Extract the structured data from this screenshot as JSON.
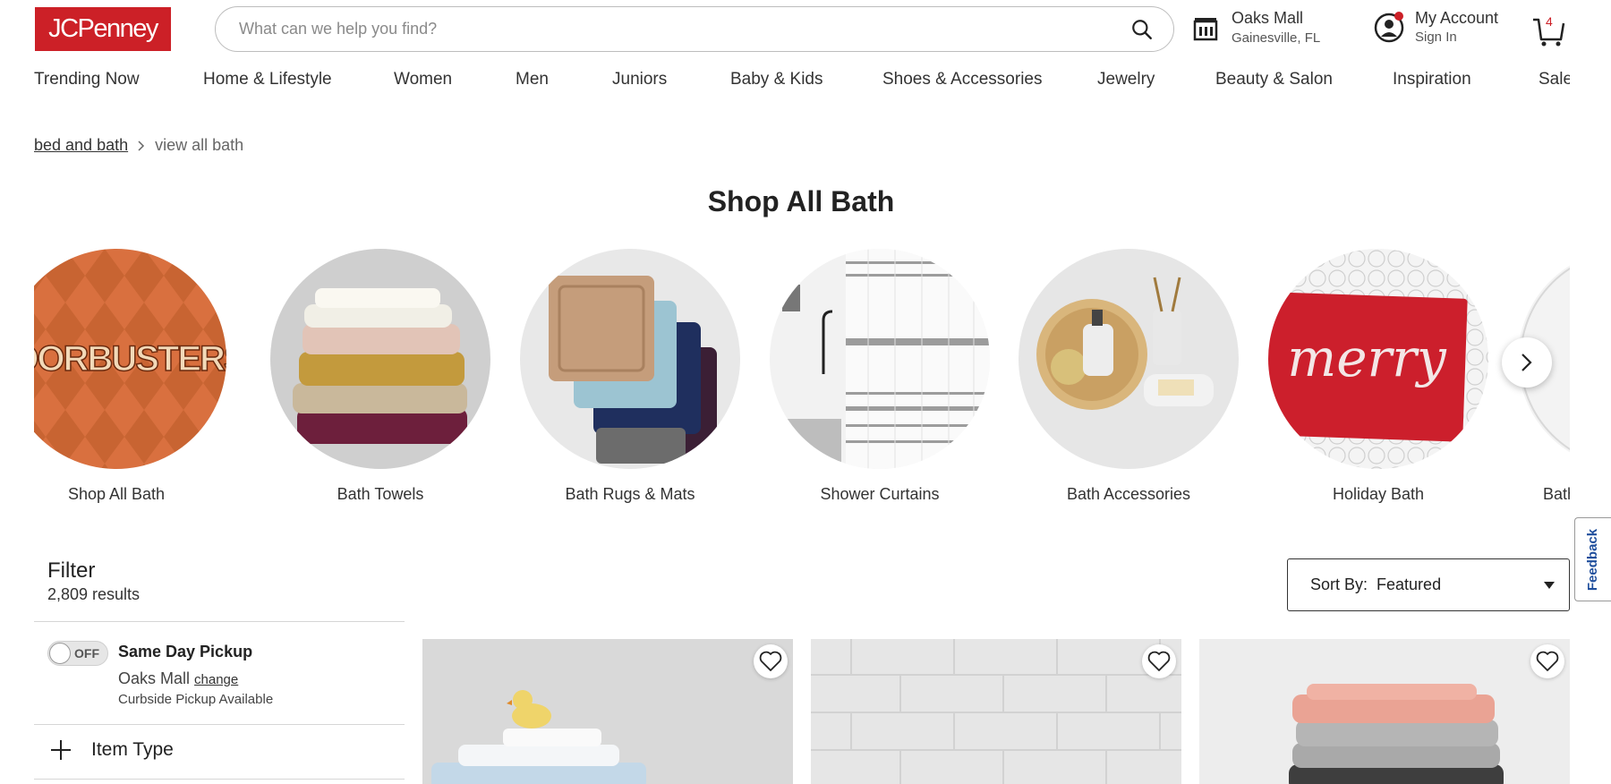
{
  "header": {
    "logo_text": "JCPenney",
    "search_placeholder": "What can we help you find?",
    "store_name": "Oaks Mall",
    "store_city": "Gainesville, FL",
    "account_title": "My Account",
    "account_sub": "Sign In",
    "cart_count": "4"
  },
  "nav": [
    "Trending Now",
    "Home & Lifestyle",
    "Women",
    "Men",
    "Juniors",
    "Baby & Kids",
    "Shoes & Accessories",
    "Jewelry",
    "Beauty & Salon",
    "Inspiration",
    "Sale"
  ],
  "breadcrumb": {
    "parent": "bed and bath",
    "current": "view all bath"
  },
  "page_title": "Shop All Bath",
  "categories": [
    {
      "label": "Shop All Bath",
      "image_text": "DOORBUSTERS"
    },
    {
      "label": "Bath Towels"
    },
    {
      "label": "Bath Rugs & Mats"
    },
    {
      "label": "Shower Curtains"
    },
    {
      "label": "Bath Accessories"
    },
    {
      "label": "Holiday Bath",
      "image_text": "merry"
    },
    {
      "label": "Bath"
    }
  ],
  "feedback_label": "Feedback",
  "filter": {
    "title": "Filter",
    "results": "2,809 results",
    "toggle_state": "OFF",
    "pickup_title": "Same Day Pickup",
    "pickup_store": "Oaks Mall",
    "pickup_change": "change",
    "curbside": "Curbside Pickup Available",
    "item_type": "Item Type"
  },
  "sort": {
    "label": "Sort By:",
    "value": "Featured"
  },
  "colors": {
    "brand": "#cc2027",
    "feedback": "#1f4e9c"
  }
}
